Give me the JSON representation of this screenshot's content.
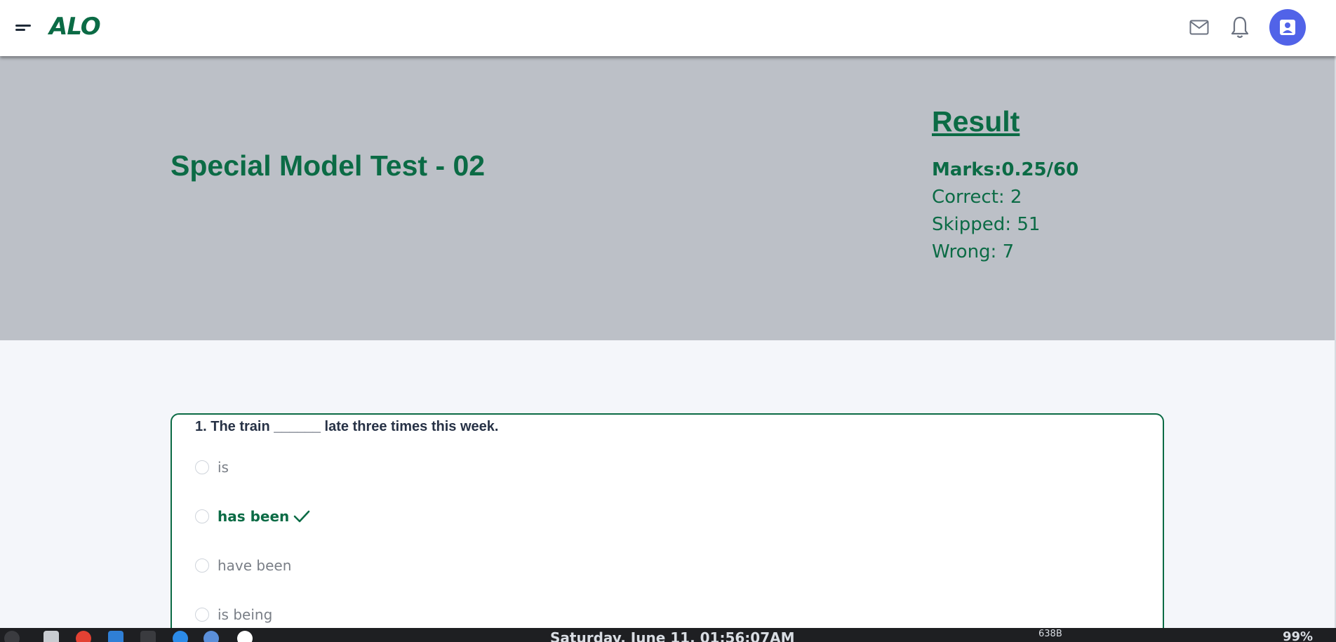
{
  "header": {
    "logo_text": "ALO",
    "accent_color": "#0b6b45",
    "avatar_color": "#5163e8",
    "icons": [
      "menu-icon",
      "mail-icon",
      "bell-icon",
      "user-avatar-icon"
    ]
  },
  "hero": {
    "test_title": "Special Model Test - 02",
    "result_heading": "Result",
    "marks": "Marks:0.25/60",
    "correct": "Correct: 2",
    "skipped": "Skipped: 51",
    "wrong": "Wrong: 7"
  },
  "question": {
    "text": "1. The train ______ late three times this week.",
    "options": [
      {
        "label": "is",
        "is_correct": false
      },
      {
        "label": "has been",
        "is_correct": true
      },
      {
        "label": "have been",
        "is_correct": false
      },
      {
        "label": "is being",
        "is_correct": false
      }
    ]
  },
  "taskbar": {
    "clock": "Saturday, June 11, 01:56:07AM",
    "network": "638B",
    "battery": "99%"
  }
}
